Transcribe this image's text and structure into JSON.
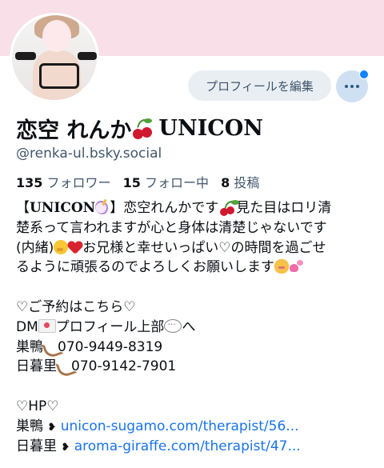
{
  "profile": {
    "display_name": "恋空 れんか",
    "display_name_suffix": "UNICON",
    "handle": "@renka-ul.bsky.social",
    "edit_button": "プロフィールを編集",
    "more_button": "···",
    "followers_count": "135",
    "followers_label": "フォロワー",
    "following_count": "15",
    "following_label": "フォロー中",
    "posts_count": "8",
    "posts_label": "投稿"
  },
  "bio": {
    "l1_a": "【",
    "l1_b": "UNICON",
    "l1_c": "】恋空れんかです",
    "l1_d": "見た目はロリ清",
    "l2": "楚系って言われますが心と身体は清楚じゃないです",
    "l3_a": "(内緒)",
    "l3_b": "お兄様と幸せいっぱい♡の時間を過ごせ",
    "l4": "るように頑張るのでよろしくお願いします",
    "l5": "♡ご予約はこちら♡",
    "l6_a": "DM",
    "l6_b": "プロフィール上部",
    "l6_c": "へ",
    "l7_a": "巣鴨",
    "l7_b": "070-9449-8319",
    "l8_a": "日暮里",
    "l8_b": "070-9142-7901",
    "l9": "♡HP♡",
    "l10_a": "巣鴨",
    "l10_link": "unicon-sugamo.com/therapist/56...",
    "l11_a": "日暮里",
    "l11_link": "aroma-giraffe.com/therapist/47..."
  },
  "colors": {
    "banner": "#f8dfe8",
    "link": "#1a73e8",
    "notification_dot": "#1083fe"
  },
  "icons": [
    "cherry-icon",
    "unicorn-icon",
    "shushing-face-icon",
    "red-heart-icon",
    "kissing-cat-icon",
    "two-hearts-icon",
    "love-letter-icon",
    "speech-bubble-icon",
    "telephone-receiver-icon"
  ]
}
